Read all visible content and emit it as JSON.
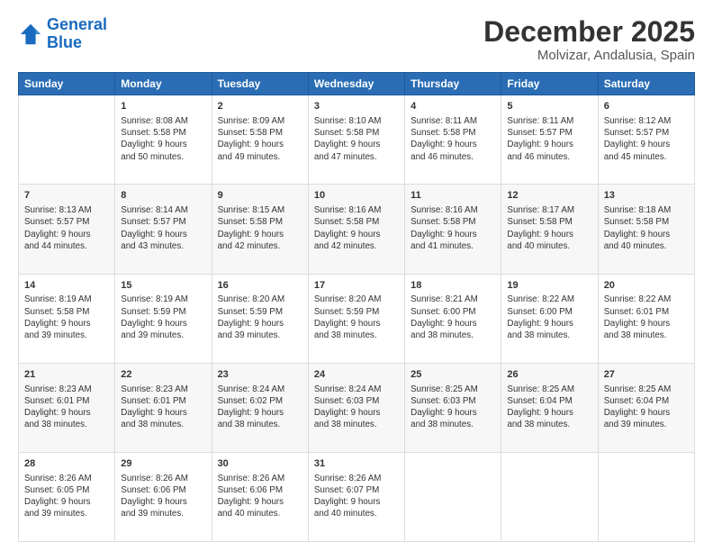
{
  "logo": {
    "text_general": "General",
    "text_blue": "Blue"
  },
  "title": "December 2025",
  "subtitle": "Molvizar, Andalusia, Spain",
  "header_days": [
    "Sunday",
    "Monday",
    "Tuesday",
    "Wednesday",
    "Thursday",
    "Friday",
    "Saturday"
  ],
  "weeks": [
    [
      {
        "day": "",
        "info": ""
      },
      {
        "day": "1",
        "info": "Sunrise: 8:08 AM\nSunset: 5:58 PM\nDaylight: 9 hours\nand 50 minutes."
      },
      {
        "day": "2",
        "info": "Sunrise: 8:09 AM\nSunset: 5:58 PM\nDaylight: 9 hours\nand 49 minutes."
      },
      {
        "day": "3",
        "info": "Sunrise: 8:10 AM\nSunset: 5:58 PM\nDaylight: 9 hours\nand 47 minutes."
      },
      {
        "day": "4",
        "info": "Sunrise: 8:11 AM\nSunset: 5:58 PM\nDaylight: 9 hours\nand 46 minutes."
      },
      {
        "day": "5",
        "info": "Sunrise: 8:11 AM\nSunset: 5:57 PM\nDaylight: 9 hours\nand 46 minutes."
      },
      {
        "day": "6",
        "info": "Sunrise: 8:12 AM\nSunset: 5:57 PM\nDaylight: 9 hours\nand 45 minutes."
      }
    ],
    [
      {
        "day": "7",
        "info": "Sunrise: 8:13 AM\nSunset: 5:57 PM\nDaylight: 9 hours\nand 44 minutes."
      },
      {
        "day": "8",
        "info": "Sunrise: 8:14 AM\nSunset: 5:57 PM\nDaylight: 9 hours\nand 43 minutes."
      },
      {
        "day": "9",
        "info": "Sunrise: 8:15 AM\nSunset: 5:58 PM\nDaylight: 9 hours\nand 42 minutes."
      },
      {
        "day": "10",
        "info": "Sunrise: 8:16 AM\nSunset: 5:58 PM\nDaylight: 9 hours\nand 42 minutes."
      },
      {
        "day": "11",
        "info": "Sunrise: 8:16 AM\nSunset: 5:58 PM\nDaylight: 9 hours\nand 41 minutes."
      },
      {
        "day": "12",
        "info": "Sunrise: 8:17 AM\nSunset: 5:58 PM\nDaylight: 9 hours\nand 40 minutes."
      },
      {
        "day": "13",
        "info": "Sunrise: 8:18 AM\nSunset: 5:58 PM\nDaylight: 9 hours\nand 40 minutes."
      }
    ],
    [
      {
        "day": "14",
        "info": "Sunrise: 8:19 AM\nSunset: 5:58 PM\nDaylight: 9 hours\nand 39 minutes."
      },
      {
        "day": "15",
        "info": "Sunrise: 8:19 AM\nSunset: 5:59 PM\nDaylight: 9 hours\nand 39 minutes."
      },
      {
        "day": "16",
        "info": "Sunrise: 8:20 AM\nSunset: 5:59 PM\nDaylight: 9 hours\nand 39 minutes."
      },
      {
        "day": "17",
        "info": "Sunrise: 8:20 AM\nSunset: 5:59 PM\nDaylight: 9 hours\nand 38 minutes."
      },
      {
        "day": "18",
        "info": "Sunrise: 8:21 AM\nSunset: 6:00 PM\nDaylight: 9 hours\nand 38 minutes."
      },
      {
        "day": "19",
        "info": "Sunrise: 8:22 AM\nSunset: 6:00 PM\nDaylight: 9 hours\nand 38 minutes."
      },
      {
        "day": "20",
        "info": "Sunrise: 8:22 AM\nSunset: 6:01 PM\nDaylight: 9 hours\nand 38 minutes."
      }
    ],
    [
      {
        "day": "21",
        "info": "Sunrise: 8:23 AM\nSunset: 6:01 PM\nDaylight: 9 hours\nand 38 minutes."
      },
      {
        "day": "22",
        "info": "Sunrise: 8:23 AM\nSunset: 6:01 PM\nDaylight: 9 hours\nand 38 minutes."
      },
      {
        "day": "23",
        "info": "Sunrise: 8:24 AM\nSunset: 6:02 PM\nDaylight: 9 hours\nand 38 minutes."
      },
      {
        "day": "24",
        "info": "Sunrise: 8:24 AM\nSunset: 6:03 PM\nDaylight: 9 hours\nand 38 minutes."
      },
      {
        "day": "25",
        "info": "Sunrise: 8:25 AM\nSunset: 6:03 PM\nDaylight: 9 hours\nand 38 minutes."
      },
      {
        "day": "26",
        "info": "Sunrise: 8:25 AM\nSunset: 6:04 PM\nDaylight: 9 hours\nand 38 minutes."
      },
      {
        "day": "27",
        "info": "Sunrise: 8:25 AM\nSunset: 6:04 PM\nDaylight: 9 hours\nand 39 minutes."
      }
    ],
    [
      {
        "day": "28",
        "info": "Sunrise: 8:26 AM\nSunset: 6:05 PM\nDaylight: 9 hours\nand 39 minutes."
      },
      {
        "day": "29",
        "info": "Sunrise: 8:26 AM\nSunset: 6:06 PM\nDaylight: 9 hours\nand 39 minutes."
      },
      {
        "day": "30",
        "info": "Sunrise: 8:26 AM\nSunset: 6:06 PM\nDaylight: 9 hours\nand 40 minutes."
      },
      {
        "day": "31",
        "info": "Sunrise: 8:26 AM\nSunset: 6:07 PM\nDaylight: 9 hours\nand 40 minutes."
      },
      {
        "day": "",
        "info": ""
      },
      {
        "day": "",
        "info": ""
      },
      {
        "day": "",
        "info": ""
      }
    ]
  ]
}
